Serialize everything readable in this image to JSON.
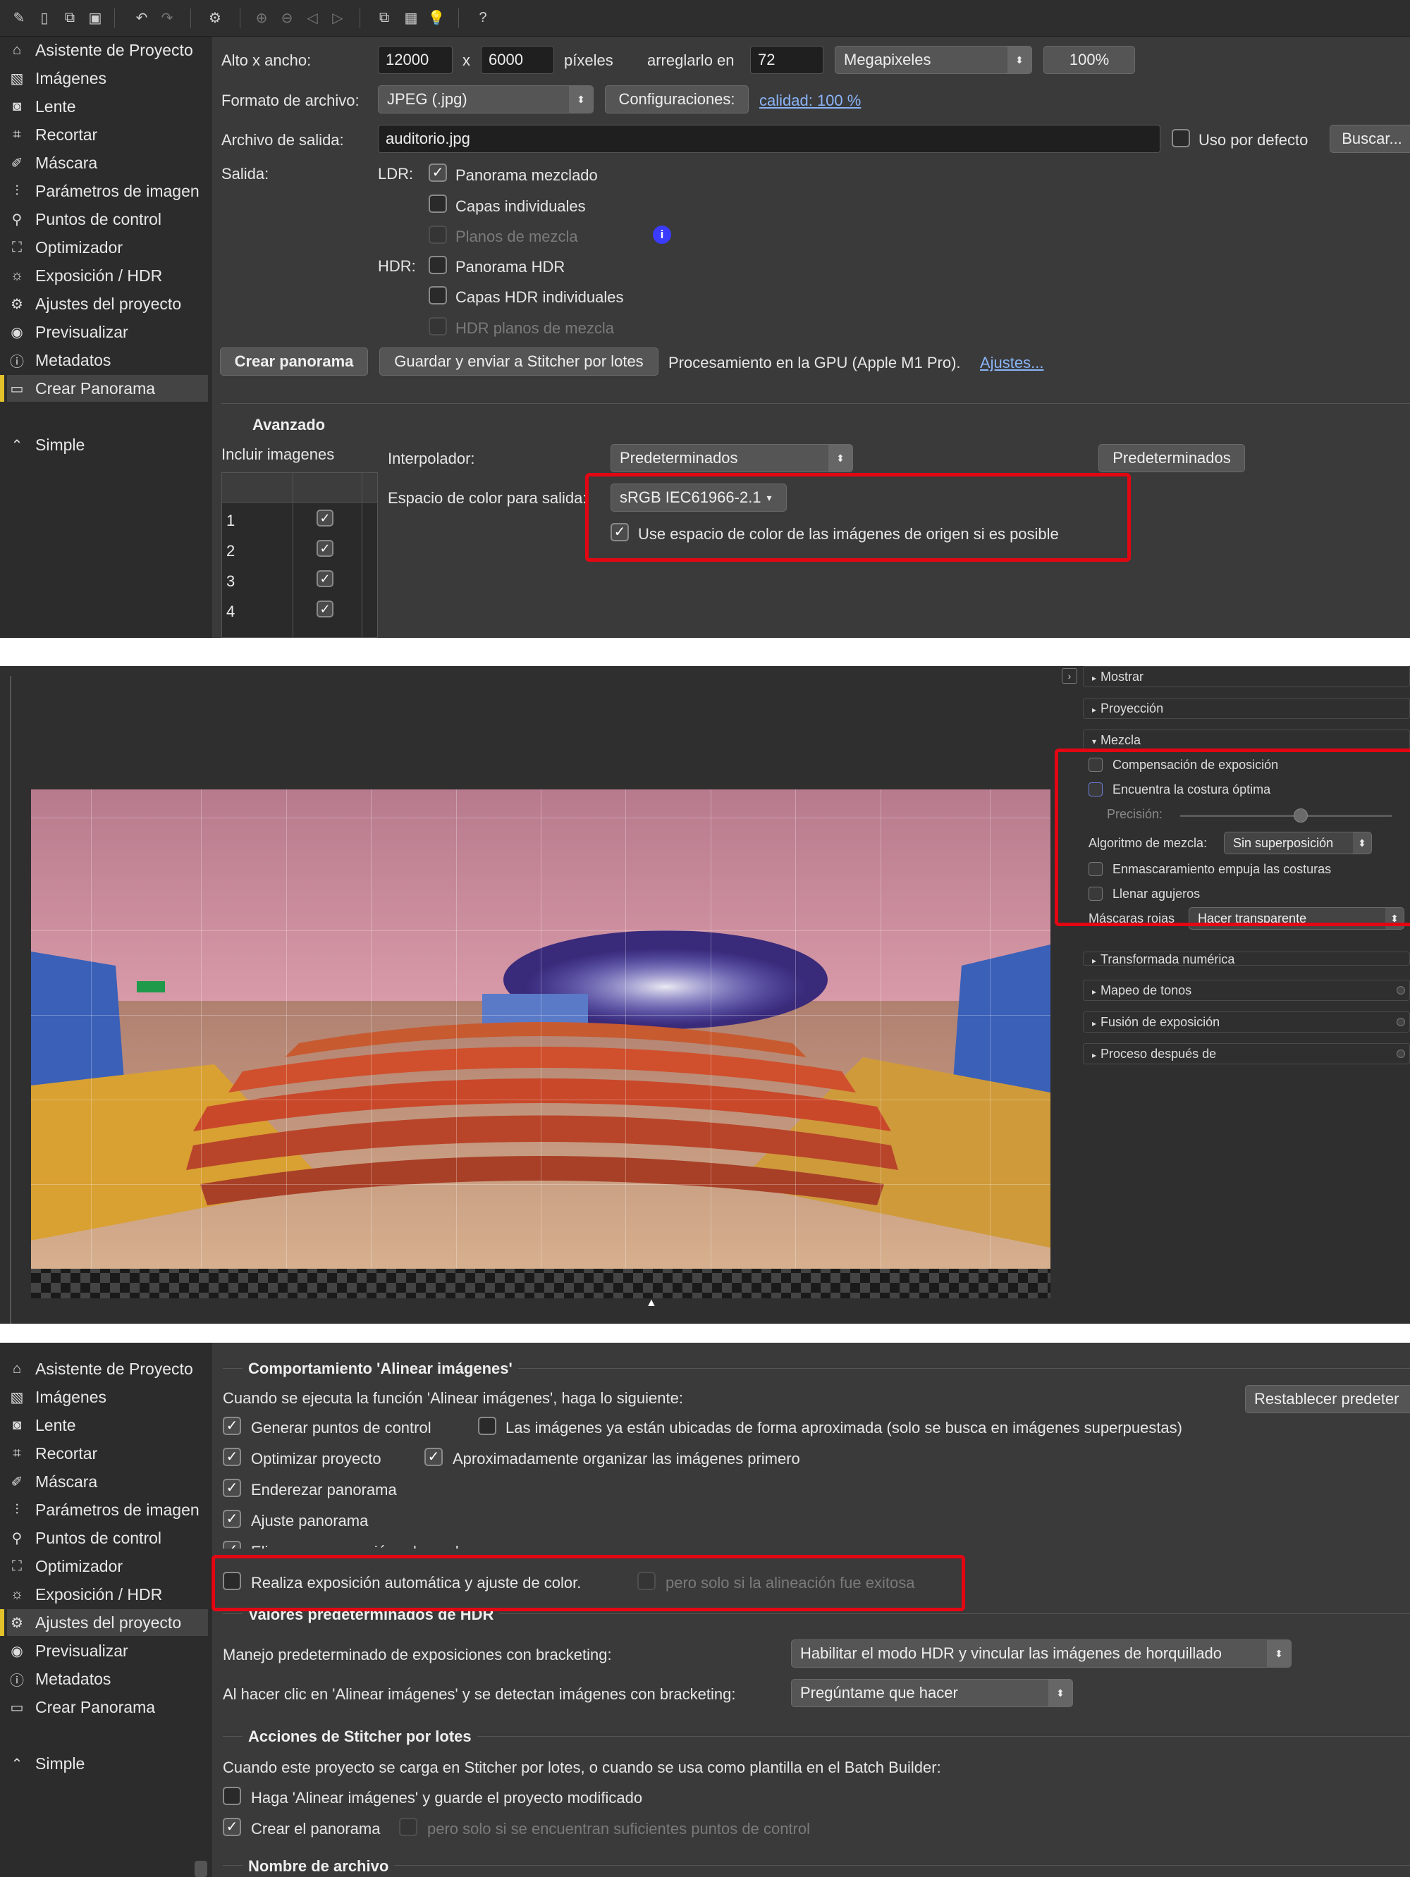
{
  "top": {
    "sidebar": [
      {
        "label": "Asistente de Proyecto",
        "icon": "home-icon"
      },
      {
        "label": "Imágenes",
        "icon": "image-icon"
      },
      {
        "label": "Lente",
        "icon": "camera-icon"
      },
      {
        "label": "Recortar",
        "icon": "crop-icon"
      },
      {
        "label": "Máscara",
        "icon": "brush-icon"
      },
      {
        "label": "Parámetros de imagen",
        "icon": "sliders-icon"
      },
      {
        "label": "Puntos de control",
        "icon": "control-points-icon"
      },
      {
        "label": "Optimizador",
        "icon": "optimizer-icon"
      },
      {
        "label": "Exposición / HDR",
        "icon": "sun-icon"
      },
      {
        "label": "Ajustes del proyecto",
        "icon": "gear-icon"
      },
      {
        "label": "Previsualizar",
        "icon": "eye-icon"
      },
      {
        "label": "Metadatos",
        "icon": "info-icon"
      },
      {
        "label": "Crear Panorama",
        "icon": "panorama-icon"
      }
    ],
    "simple_label": "Simple",
    "size_label": "Alto x ancho:",
    "height_value": "12000",
    "x_sep": "x",
    "width_value": "6000",
    "pixels_label": "píxeles",
    "fix_label": "arreglarlo en",
    "fix_value": "72",
    "unit_select": "Megapixeles",
    "zoom_button": "100%",
    "format_label": "Formato de archivo:",
    "format_select": "JPEG (.jpg)",
    "config_button": "Configuraciones:",
    "quality_link": "calidad: 100 %",
    "output_file_label": "Archivo de salida:",
    "output_file_value": "auditorio.jpg",
    "default_use_label": "Uso por defecto",
    "browse_button": "Buscar...",
    "output_label": "Salida:",
    "ldr_label": "LDR:",
    "hdr_label": "HDR:",
    "ldr_options": [
      {
        "label": "Panorama mezclado",
        "checked": "✓"
      },
      {
        "label": "Capas individuales",
        "checked": ""
      },
      {
        "label": "Planos de mezcla",
        "checked": ""
      }
    ],
    "hdr_options": [
      {
        "label": "Panorama HDR",
        "checked": ""
      },
      {
        "label": "Capas HDR individuales",
        "checked": ""
      },
      {
        "label": "HDR planos de mezcla",
        "checked": ""
      }
    ],
    "create_button": "Crear panorama",
    "batch_button": "Guardar y enviar a Stitcher por lotes",
    "gpu_text": "Procesamiento en la GPU (Apple M1 Pro).",
    "settings_link": "Ajustes...",
    "advanced_title": "Avanzado",
    "include_images_label": "Incluir imagenes",
    "image_rows": [
      {
        "num": "1",
        "mark": "✓"
      },
      {
        "num": "2",
        "mark": "✓"
      },
      {
        "num": "3",
        "mark": "✓"
      },
      {
        "num": "4",
        "mark": "✓"
      }
    ],
    "interpolator_label": "Interpolador:",
    "interpolator_select": "Predeterminados",
    "defaults_button": "Predeterminados",
    "colorspace_label": "Espacio de color para salida:",
    "colorspace_select": "sRGB IEC61966-2.1",
    "use_source_colorspace": "Use espacio de color de las imágenes de origen si es posible",
    "use_source_mark": "✓"
  },
  "middle": {
    "panels": [
      {
        "label": "Mostrar"
      },
      {
        "label": "Proyección"
      },
      {
        "label": "Mezcla"
      }
    ],
    "blend": {
      "exposure_comp": "Compensación de exposición",
      "optimal_seam": "Encuentra la costura óptima",
      "precision_label": "Precisión:",
      "precision_level": 0.57,
      "algorithm_label": "Algoritmo de mezcla:",
      "algorithm_select": "Sin superposición",
      "mask_push": "Enmascaramiento empuja las costuras",
      "fill_holes": "Llenar agujeros",
      "red_masks_label": "Máscaras rojas",
      "red_masks_select": "Hacer transparente"
    },
    "collapsed_panels": [
      {
        "label": "Transformada numérica"
      },
      {
        "label": "Mapeo de tonos"
      },
      {
        "label": "Fusión de exposición"
      },
      {
        "label": "Proceso después de"
      }
    ],
    "colors": {
      "ceiling": "#c98a9a",
      "floor": "#c9a07a",
      "seats": "#d0502d",
      "walls": "#3a60b8"
    }
  },
  "bottom": {
    "sidebar": [
      {
        "label": "Asistente de Proyecto",
        "icon": "home-icon"
      },
      {
        "label": "Imágenes",
        "icon": "image-icon"
      },
      {
        "label": "Lente",
        "icon": "camera-icon"
      },
      {
        "label": "Recortar",
        "icon": "crop-icon"
      },
      {
        "label": "Máscara",
        "icon": "brush-icon"
      },
      {
        "label": "Parámetros de imagen",
        "icon": "sliders-icon"
      },
      {
        "label": "Puntos de control",
        "icon": "control-points-icon"
      },
      {
        "label": "Optimizador",
        "icon": "optimizer-icon"
      },
      {
        "label": "Exposición / HDR",
        "icon": "sun-icon"
      },
      {
        "label": "Ajustes del proyecto",
        "icon": "gear-icon"
      },
      {
        "label": "Previsualizar",
        "icon": "eye-icon"
      },
      {
        "label": "Metadatos",
        "icon": "info-icon"
      },
      {
        "label": "Crear Panorama",
        "icon": "panorama-icon"
      }
    ],
    "simple_label": "Simple",
    "align_title": "Comportamiento 'Alinear imágenes'",
    "align_intro": "Cuando se ejecuta la función 'Alinear imágenes', haga lo siguiente:",
    "reset_button": "Restablecer predeter",
    "align_left": [
      {
        "label": "Generar puntos de control",
        "mark": "✓"
      },
      {
        "label": "Optimizar proyecto",
        "mark": "✓"
      },
      {
        "label": "Enderezar panorama",
        "mark": "✓"
      },
      {
        "label": "Ajuste panorama",
        "mark": "✓"
      },
      {
        "label": "Elige una proyección adecuada",
        "mark": "✓"
      },
      {
        "label": "Realiza exposición automática y ajuste de color.",
        "mark": ""
      }
    ],
    "align_right": [
      {
        "label": "Las imágenes ya están ubicadas de forma aproximada (solo se busca en imágenes superpuestas)",
        "mark": ""
      },
      {
        "label": "Aproximadamente organizar las imágenes primero",
        "mark": "✓"
      },
      {
        "label": "pero solo si la alineación fue exitosa",
        "mark": ""
      }
    ],
    "hdr_title": "Valores predeterminados de HDR",
    "bracket_label": "Manejo predeterminado de exposiciones con bracketing:",
    "bracket_select": "Habilitar el modo HDR y vincular las imágenes de horquillado",
    "detect_label": "Al hacer clic en 'Alinear imágenes' y se detectan imágenes con bracketing:",
    "detect_select": "Pregúntame que hacer",
    "batch_title": "Acciones de Stitcher por lotes",
    "batch_intro": "Cuando este proyecto se carga en Stitcher por lotes, o cuando se usa como plantilla en el Batch Builder:",
    "batch_opt1": "Haga 'Alinear imágenes' y guarde el proyecto modificado",
    "batch_opt1_mark": "",
    "batch_opt2": "Crear el panorama",
    "batch_opt2_mark": "✓",
    "batch_opt3": "pero solo si se encuentran suficientes puntos de control",
    "filename_title": "Nombre de archivo"
  }
}
